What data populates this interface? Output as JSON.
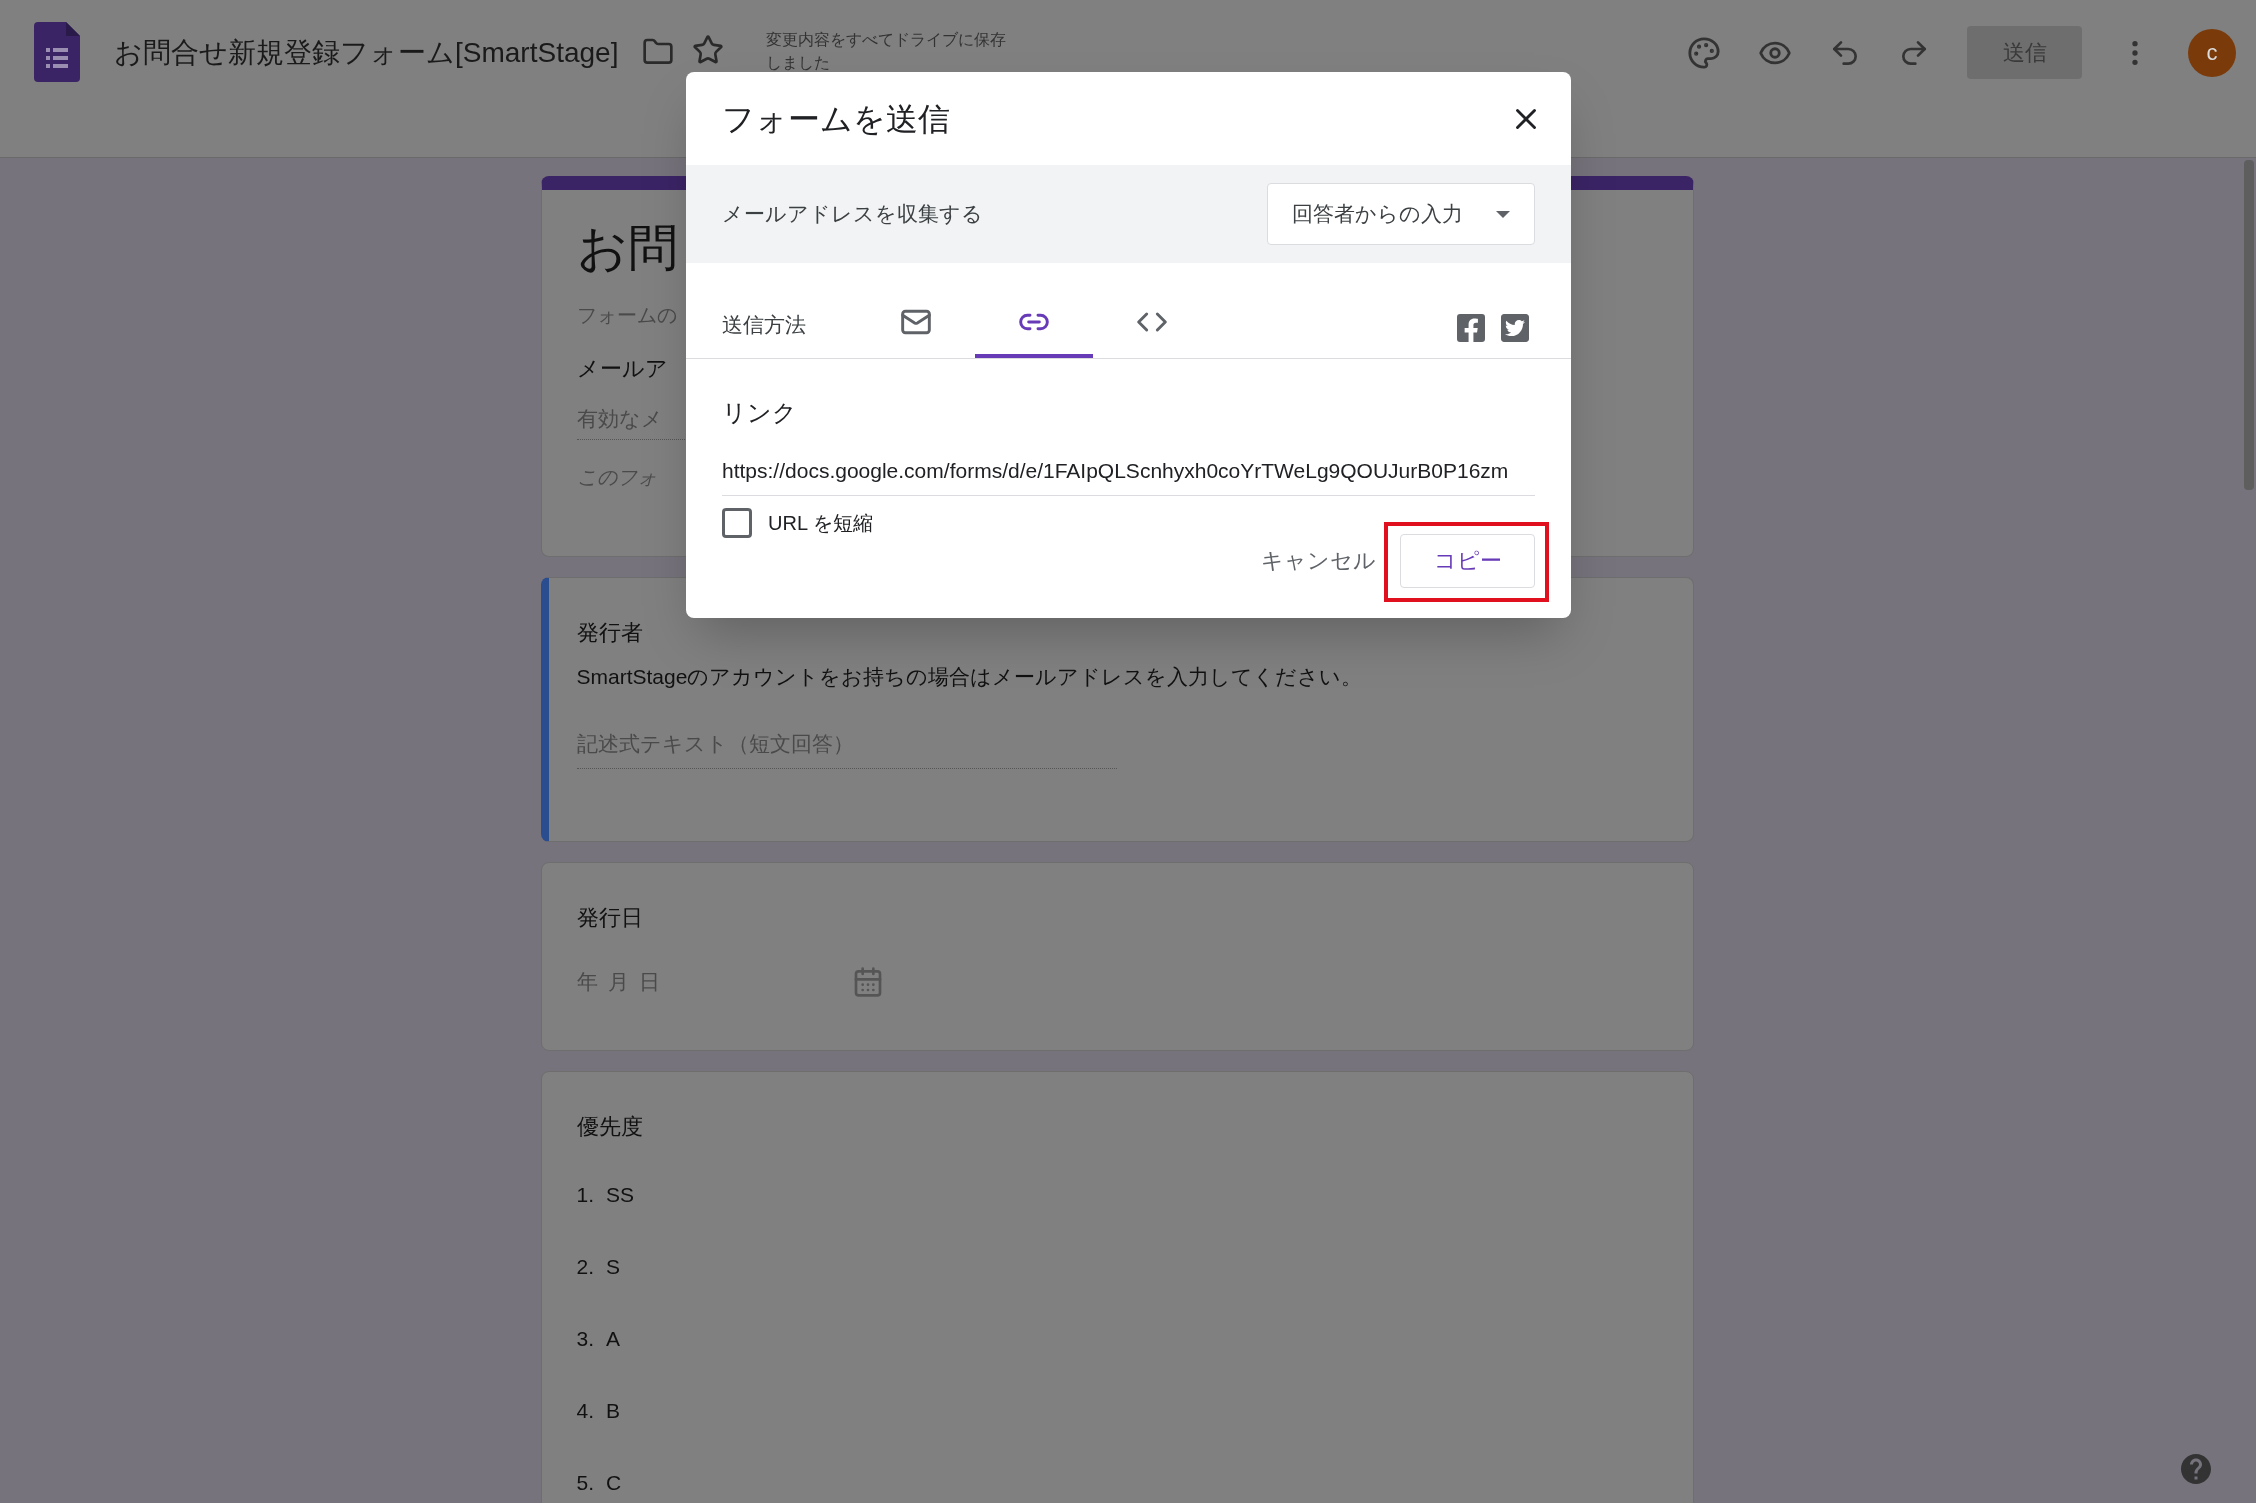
{
  "header": {
    "title": "お問合せ新規登録フォーム[SmartStage]",
    "saved_status": "変更内容をすべてドライブに保存しました",
    "send_button": "送信",
    "avatar": "c"
  },
  "form_header": {
    "title": "お問",
    "description": "フォームの",
    "email_label": "メールア",
    "email_placeholder": "有効なメ",
    "note": "このフォ"
  },
  "questions": [
    {
      "kind": "short_text",
      "title": "発行者",
      "description": "SmartStageのアカウントをお持ちの場合はメールアドレスを入力してください。",
      "placeholder": "記述式テキスト（短文回答）",
      "selected": true
    },
    {
      "kind": "date",
      "title": "発行日",
      "placeholder": "年 月 日",
      "selected": false
    },
    {
      "kind": "list",
      "title": "優先度",
      "selected": false,
      "options": [
        {
          "number": "1.",
          "label": "SS"
        },
        {
          "number": "2.",
          "label": "S"
        },
        {
          "number": "3.",
          "label": "A"
        },
        {
          "number": "4.",
          "label": "B"
        },
        {
          "number": "5.",
          "label": "C"
        }
      ]
    }
  ],
  "dialog": {
    "title": "フォームを送信",
    "email_collection": {
      "label": "メールアドレスを収集する",
      "value": "回答者からの入力"
    },
    "method_label": "送信方法",
    "tabs": [
      {
        "kind": "email",
        "selected": false
      },
      {
        "kind": "link",
        "selected": true
      },
      {
        "kind": "embed",
        "selected": false
      }
    ],
    "section_title": "リンク",
    "url": "https://docs.google.com/forms/d/e/1FAIpQLScnhyxh0coYrTWeLg9QOUJurB0P16zm",
    "shorten_url": {
      "label": "URL を短縮",
      "checked": false
    },
    "cancel_button": "キャンセル",
    "copy_button": "コピー",
    "copy_highlighted": true
  }
}
